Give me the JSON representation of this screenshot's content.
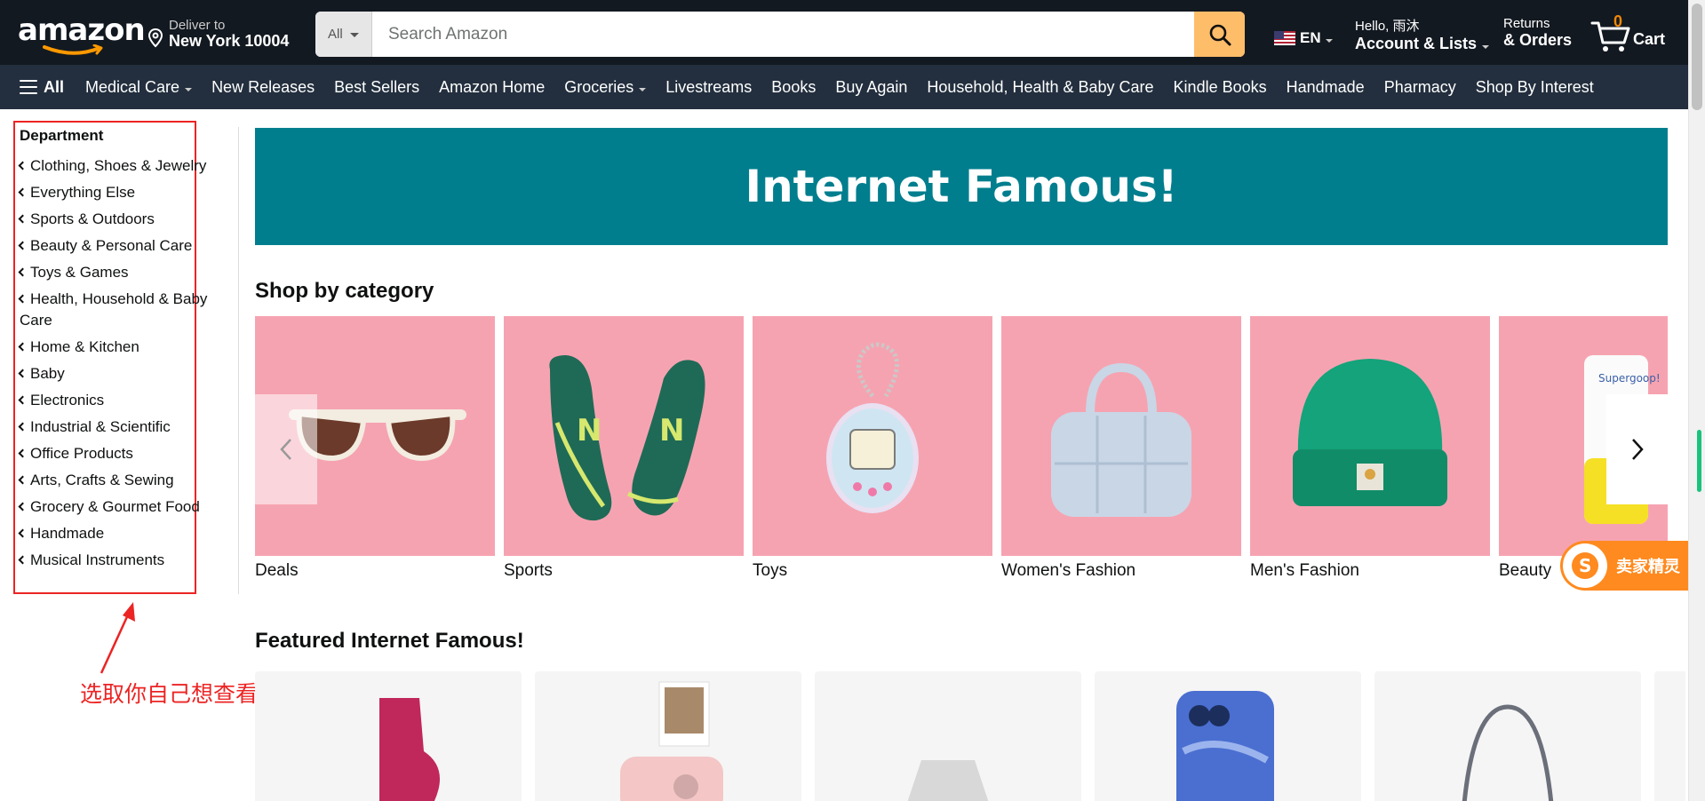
{
  "header": {
    "logo_text": "amazon",
    "deliver_line1": "Deliver to",
    "deliver_line2": "New York 10004",
    "search_category": "All",
    "search_placeholder": "Search Amazon",
    "language": "EN",
    "account_line1": "Hello, 雨沐",
    "account_line2": "Account & Lists",
    "returns_line1": "Returns",
    "returns_line2": "& Orders",
    "cart_count": "0",
    "cart_label": "Cart"
  },
  "nav": {
    "all_label": "All",
    "items": [
      {
        "label": "Medical Care",
        "dropdown": true
      },
      {
        "label": "New Releases",
        "dropdown": false
      },
      {
        "label": "Best Sellers",
        "dropdown": false
      },
      {
        "label": "Amazon Home",
        "dropdown": false
      },
      {
        "label": "Groceries",
        "dropdown": true
      },
      {
        "label": "Livestreams",
        "dropdown": false
      },
      {
        "label": "Books",
        "dropdown": false
      },
      {
        "label": "Buy Again",
        "dropdown": false
      },
      {
        "label": "Household, Health & Baby Care",
        "dropdown": false
      },
      {
        "label": "Kindle Books",
        "dropdown": false
      },
      {
        "label": "Handmade",
        "dropdown": false
      },
      {
        "label": "Pharmacy",
        "dropdown": false
      },
      {
        "label": "Shop By Interest",
        "dropdown": false
      }
    ]
  },
  "sidebar": {
    "heading": "Department",
    "items": [
      "Clothing, Shoes & Jewelry",
      "Everything Else",
      "Sports & Outdoors",
      "Beauty & Personal Care",
      "Toys & Games",
      "Health, Household & Baby Care",
      "Home & Kitchen",
      "Baby",
      "Electronics",
      "Industrial & Scientific",
      "Office Products",
      "Arts, Crafts & Sewing",
      "Grocery & Gourmet Food",
      "Handmade",
      "Musical Instruments"
    ]
  },
  "annotation": {
    "text": "选取你自己想查看的类目",
    "color": "#ec2424"
  },
  "banner": {
    "title": "Internet Famous!",
    "color": "#007e8e"
  },
  "shop_by_category": {
    "title": "Shop by category",
    "tile_color": "#f6a3b1",
    "items": [
      "Deals",
      "Sports",
      "Toys",
      "Women's Fashion",
      "Men's Fashion",
      "Beauty"
    ]
  },
  "featured": {
    "title": "Featured Internet Famous!"
  },
  "badge": {
    "label": "卖家精灵",
    "color": "#ff8a1f"
  }
}
